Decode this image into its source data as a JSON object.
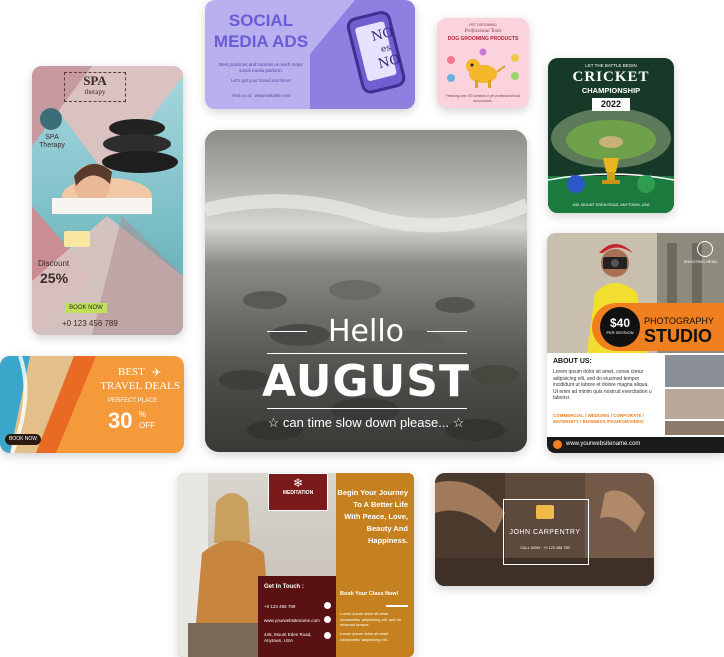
{
  "social": {
    "title_line1": "SOCIAL",
    "title_line2": "MEDIA ADS",
    "body": "Best practices and tutorials on each major social media platform.",
    "sub": "Let's get your brand out there!",
    "url": "Visit us at : www.website.com",
    "phone_text1": "NO",
    "phone_text2": "es",
    "phone_text3": "NO"
  },
  "dog": {
    "small1": "PET GROOMING",
    "script": "Professional Tools",
    "title": "DOG GROOMING PRODUCTS",
    "footer": "Featuring over 200 varieties of pet professional tools and products."
  },
  "spa": {
    "title": "SPA",
    "subtitle": "therapy",
    "logo_label": "SPA\nTherapy",
    "discount_label": "Discount",
    "discount_value": "25%",
    "button": "BOOK NOW",
    "phone": "+0 123 456 789"
  },
  "cricket": {
    "top": "LET THE BATTLE BEGIN",
    "title": "CRICKET",
    "subtitle": "CHAMPIONSHIP",
    "year": "2022",
    "address": "445, MOUNT EDEN ROAD, ANYTOWN, USA"
  },
  "hero": {
    "hello": "Hello",
    "month": "AUGUST",
    "tagline": "can time slow down please...",
    "star": "☆"
  },
  "photo": {
    "brand": "SHOOTING HEAD",
    "price": "$40",
    "price_sub": "PER SESSION",
    "title1": "PHOTOGRAPHY",
    "title2": "STUDIO",
    "about": "ABOUT US:",
    "about_text": "Lorem ipsum dolor sit amet, conse ctetur adipisicing elit, sed do eiusmod tempor incididunt ut labore et dolore magna aliqua. Ut enim ad minim quis nostrud exercitation u laborisi.",
    "categories": "COMMERCIAL / WEDDING / CORPORATE / MATERNITY / BUSINESS /FASHION/VIDEO",
    "website": "www.yourwebsitename.com"
  },
  "travel": {
    "best": "BEST",
    "deals": "TRAVEL DEALS",
    "perfect": "PERFECT PLACE",
    "value": "30",
    "percent": "%",
    "off": "OFF",
    "button": "BOOK NOW"
  },
  "med": {
    "badge": "MEDITATION",
    "quote": "Begin Your Journey To A Better Life With Peace, Love, Beauty And Happiness.",
    "contact_title": "Get In Touch :",
    "phone": "+0 123 456 789",
    "web": "www.yourwebsitename.com",
    "address": "445, Mount Eden Road, Anytown, USA",
    "cta": "Book Your Class Now!",
    "lorem1": "Lorem ipsum dolor sit amet consectetur adipisicing elit, sed do eiusmod tempor.",
    "lorem2": "Lorem ipsum dolor sit amet consectetur adipisicing elit."
  },
  "carp": {
    "title": "JOHN CARPENTRY",
    "sub": "CALL NOW : +0 123 456 789"
  }
}
